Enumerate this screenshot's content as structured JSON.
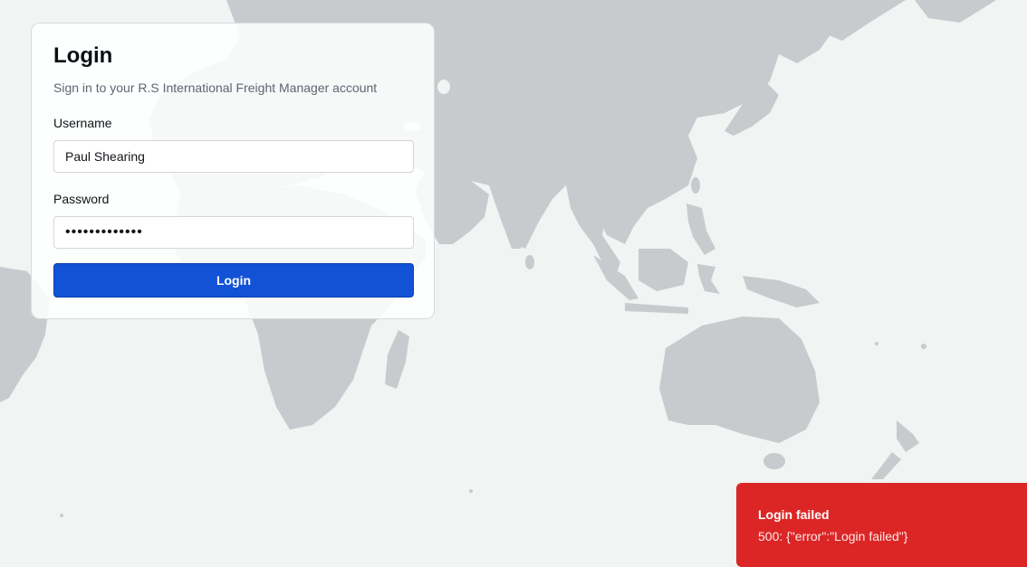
{
  "login": {
    "title": "Login",
    "subtitle": "Sign in to your R.S International Freight Manager account",
    "username_label": "Username",
    "username_value": "Paul Shearing",
    "password_label": "Password",
    "password_value": "•••••••••••••",
    "submit_label": "Login"
  },
  "toast": {
    "title": "Login failed",
    "message": "500: {\"error\":\"Login failed\"}",
    "color": "#dc2626"
  },
  "colors": {
    "primary_button": "#1252d6",
    "land": "#c8cbcd",
    "sea": "#f2f3f3"
  }
}
